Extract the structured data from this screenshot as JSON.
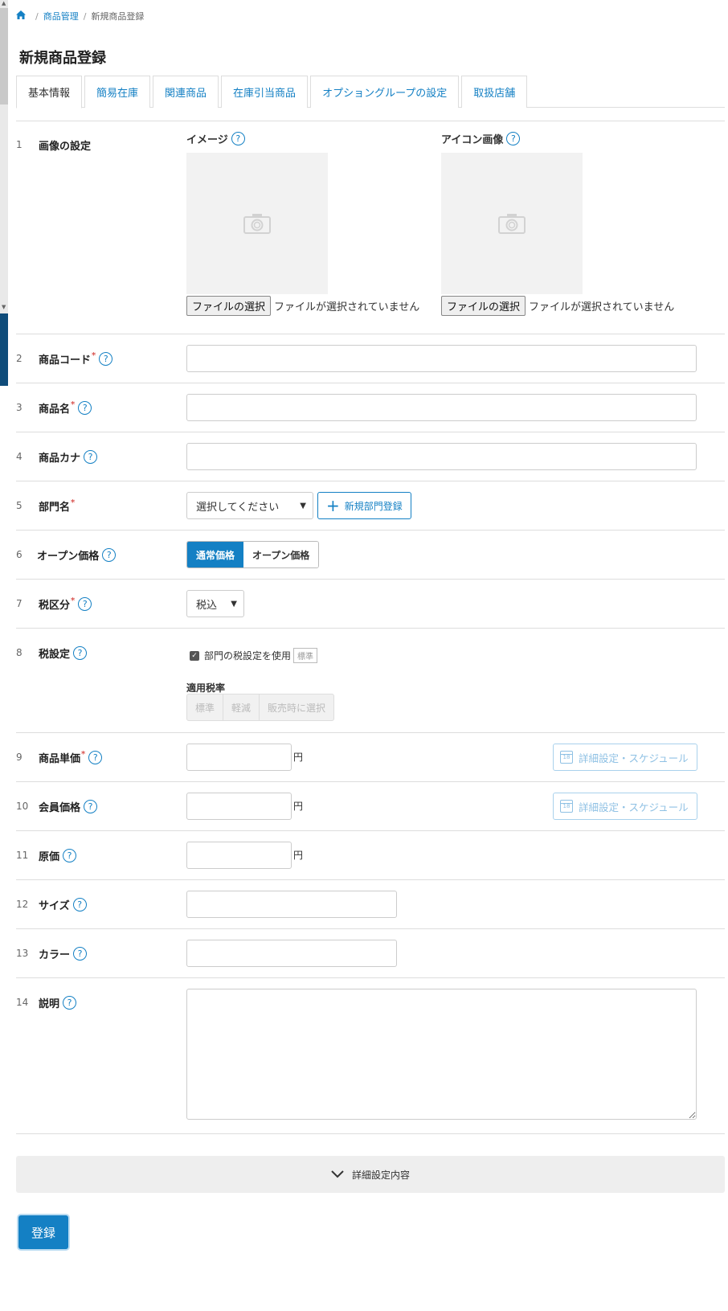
{
  "breadcrumb": {
    "home_icon": "home-icon",
    "items": [
      "商品管理",
      "新規商品登録"
    ]
  },
  "page": {
    "title": "新規商品登録"
  },
  "tabs": [
    {
      "label": "基本情報",
      "active": true
    },
    {
      "label": "簡易在庫",
      "active": false
    },
    {
      "label": "関連商品",
      "active": false
    },
    {
      "label": "在庫引当商品",
      "active": false
    },
    {
      "label": "オプショングループの設定",
      "active": false
    },
    {
      "label": "取扱店舗",
      "active": false
    }
  ],
  "help_mark": "?",
  "required_mark": "*",
  "rows": {
    "images": {
      "num": "1",
      "label": "画像の設定",
      "image": {
        "title": "イメージ",
        "button": "ファイルの選択",
        "status": "ファイルが選択されていません"
      },
      "icon": {
        "title": "アイコン画像",
        "button": "ファイルの選択",
        "status": "ファイルが選択されていません"
      }
    },
    "code": {
      "num": "2",
      "label": "商品コード",
      "value": ""
    },
    "name": {
      "num": "3",
      "label": "商品名",
      "value": ""
    },
    "kana": {
      "num": "4",
      "label": "商品カナ",
      "value": ""
    },
    "dept": {
      "num": "5",
      "label": "部門名",
      "selected": "選択してください",
      "add_button": "新規部門登録"
    },
    "open_price": {
      "num": "6",
      "label": "オープン価格",
      "options": [
        "通常価格",
        "オープン価格"
      ],
      "selected": "通常価格"
    },
    "tax_class": {
      "num": "7",
      "label": "税区分",
      "selected": "税込"
    },
    "tax_setting": {
      "num": "8",
      "label": "税設定",
      "checkbox_label": "部門の税設定を使用",
      "checked": true,
      "badge": "標準",
      "rate_label": "適用税率",
      "rate_options": [
        "標準",
        "軽減",
        "販売時に選択"
      ]
    },
    "unit_price": {
      "num": "9",
      "label": "商品単価",
      "unit": "円",
      "value": "",
      "schedule_button": "詳細設定・スケジュール"
    },
    "member_price": {
      "num": "10",
      "label": "会員価格",
      "unit": "円",
      "value": "",
      "schedule_button": "詳細設定・スケジュール"
    },
    "cost": {
      "num": "11",
      "label": "原価",
      "unit": "円",
      "value": ""
    },
    "size": {
      "num": "12",
      "label": "サイズ",
      "value": ""
    },
    "color": {
      "num": "13",
      "label": "カラー",
      "value": ""
    },
    "description": {
      "num": "14",
      "label": "説明",
      "value": ""
    }
  },
  "details": {
    "label": "詳細設定内容"
  },
  "submit": {
    "label": "登録"
  },
  "colors": {
    "accent": "#1480c4",
    "required": "#d9534f"
  }
}
